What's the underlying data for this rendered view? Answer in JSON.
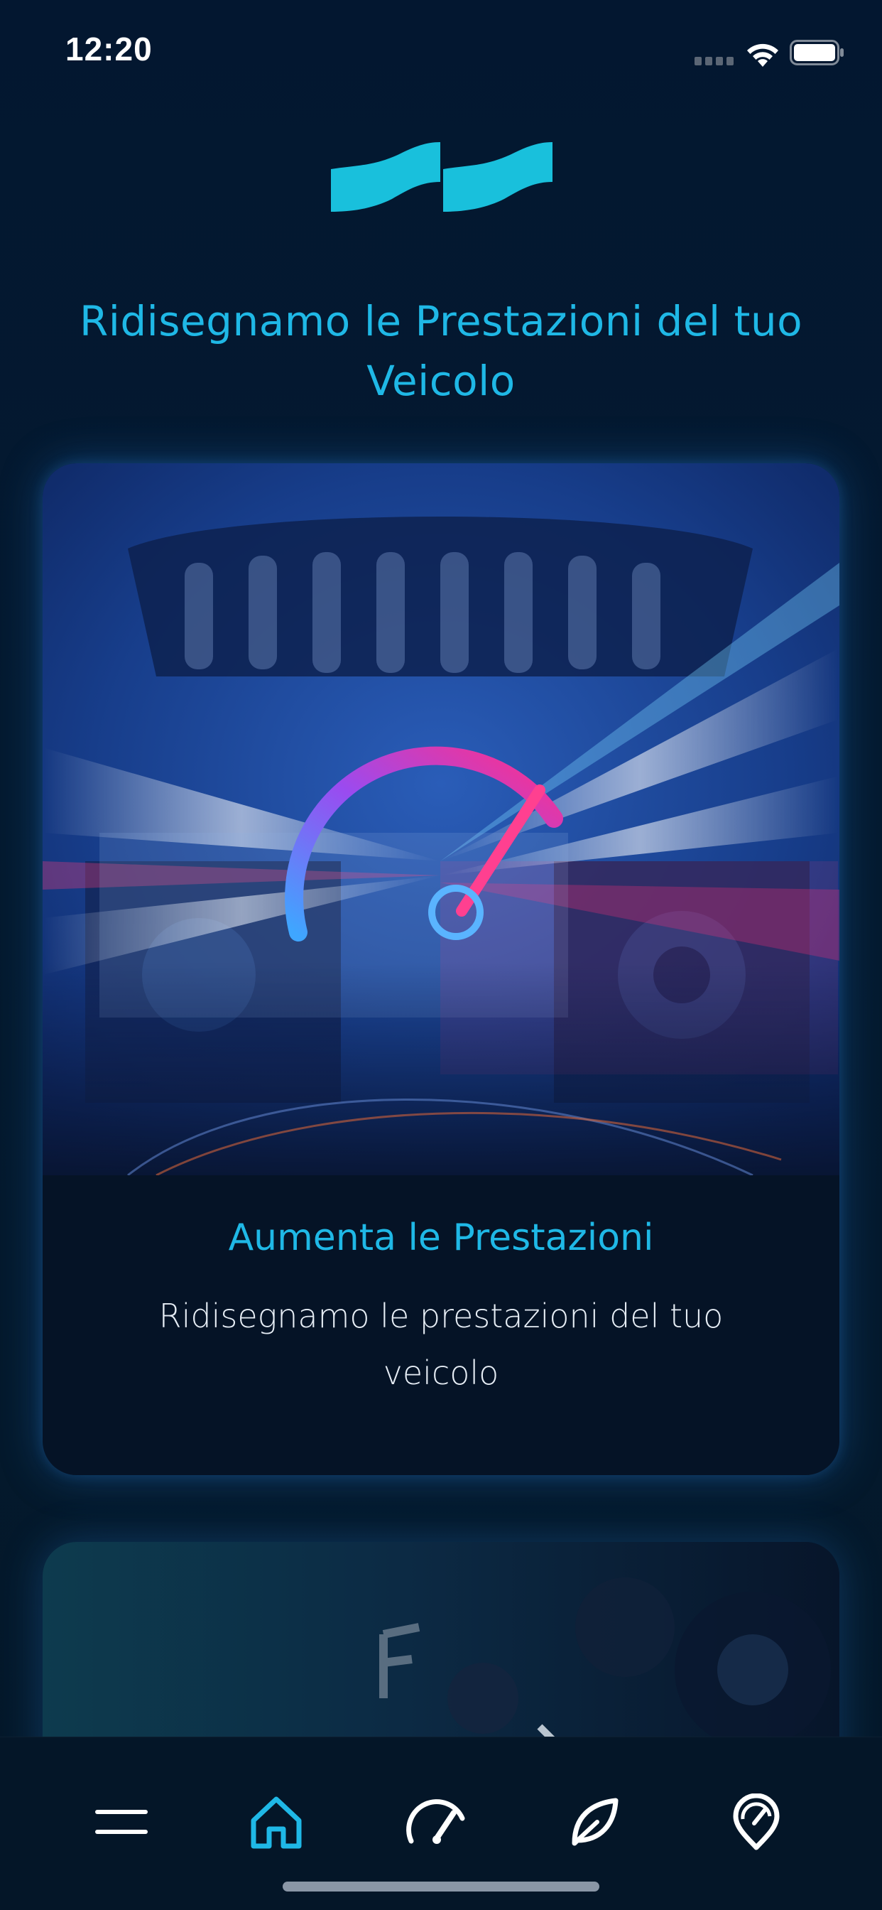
{
  "status_bar": {
    "time": "12:20"
  },
  "brand": {
    "logo_icon": "wave-logo-icon",
    "accent_color": "#1fb8e6"
  },
  "headline": "Ridisegnamo le Prestazioni del tuo Veicolo",
  "cards": [
    {
      "title": "Aumenta le Prestazioni",
      "description": "Ridisegnamo le prestazioni del tuo veicolo",
      "image_icon": "engine-speedometer-image"
    },
    {
      "image_icon": "engine-eco-image"
    }
  ],
  "tab_bar": {
    "active_tab": "home",
    "tabs": [
      {
        "id": "menu",
        "icon": "hamburger-menu-icon"
      },
      {
        "id": "home",
        "icon": "home-icon"
      },
      {
        "id": "performance",
        "icon": "speedometer-icon"
      },
      {
        "id": "eco",
        "icon": "leaf-icon"
      },
      {
        "id": "locator",
        "icon": "map-pin-gauge-icon"
      }
    ]
  }
}
